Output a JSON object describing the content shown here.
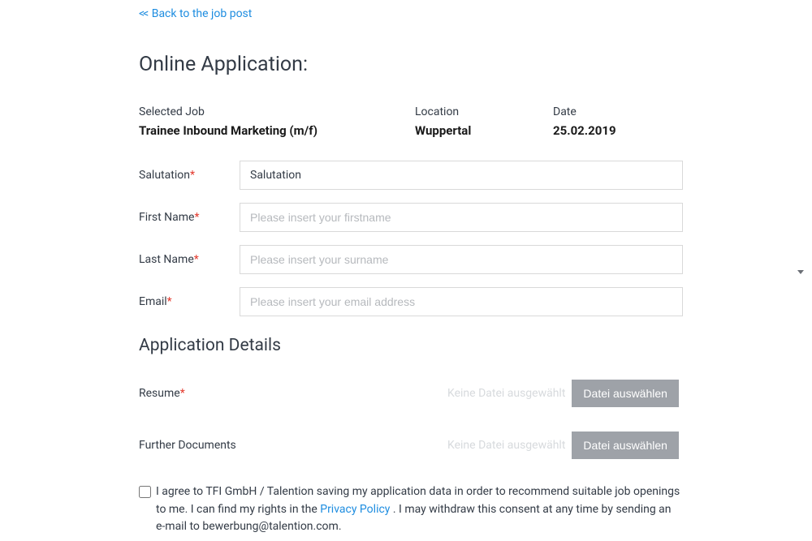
{
  "back_link": "<< Back to the job post",
  "page_title": "Online Application:",
  "job": {
    "selected_label": "Selected Job",
    "selected_value": "Trainee Inbound Marketing (m/f)",
    "location_label": "Location",
    "location_value": "Wuppertal",
    "date_label": "Date",
    "date_value": "25.02.2019"
  },
  "form": {
    "salutation_label": "Salutation",
    "salutation_value": "Salutation",
    "first_name_label": "First Name",
    "first_name_placeholder": "Please insert your firstname",
    "last_name_label": "Last Name",
    "last_name_placeholder": "Please insert your surname",
    "email_label": "Email",
    "email_placeholder": "Please insert your email address"
  },
  "details": {
    "section_title": "Application Details",
    "resume_label": "Resume",
    "resume_status": "Keine Datei ausgewählt",
    "resume_button": "Datei auswählen",
    "further_label": "Further Documents",
    "further_status": "Keine Datei ausgewählt",
    "further_button": "Datei auswählen"
  },
  "consent": {
    "text_before": "I agree to TFI GmbH / Talention saving my application data in order to recommend suitable job openings to me. I can find my rights in the ",
    "privacy_link": "Privacy Policy",
    "text_after": " . I may withdraw this consent at any time by sending an e-mail to bewerbung@talention.com.",
    "email": "bewerbung@talention.com"
  },
  "required_marker": "*"
}
